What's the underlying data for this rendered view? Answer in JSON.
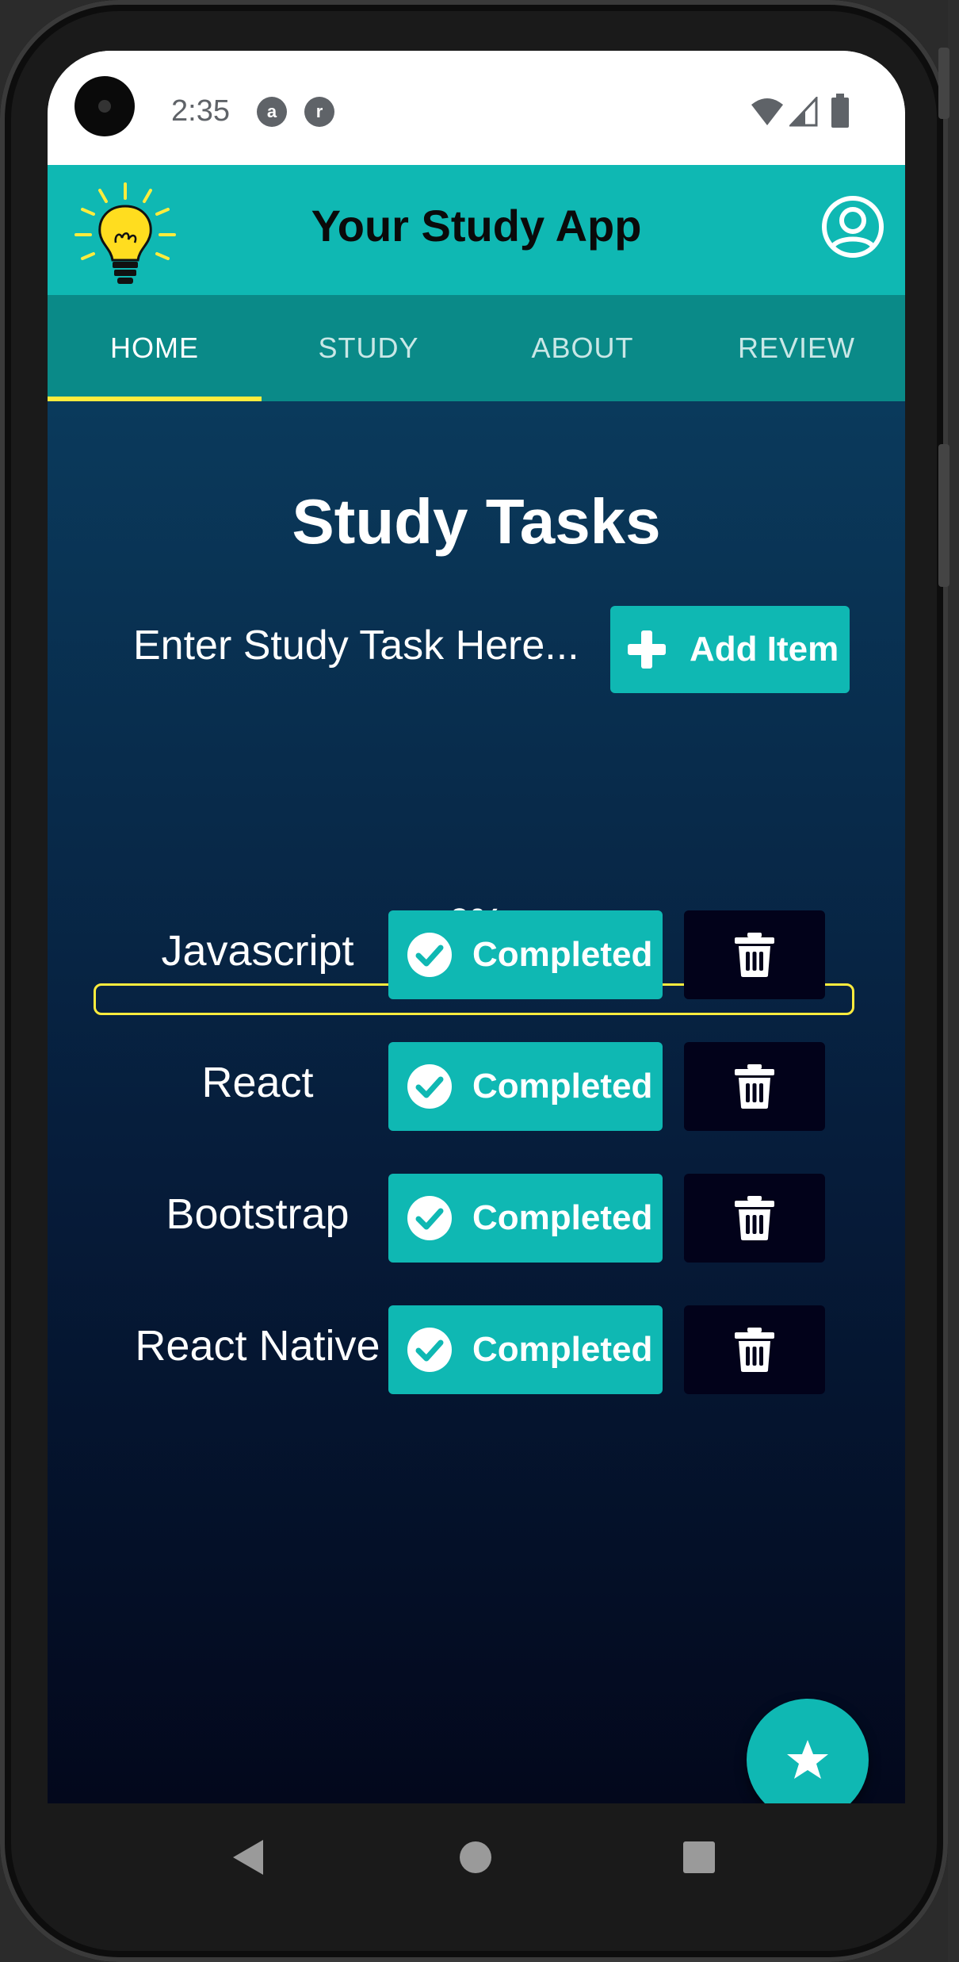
{
  "status_bar": {
    "time": "2:35",
    "notification_icons": [
      "a",
      "r"
    ]
  },
  "header": {
    "title": "Your Study App",
    "logo_icon": "lightbulb-icon",
    "profile_icon": "user-circle-icon"
  },
  "tabs": [
    {
      "label": "HOME",
      "active": true
    },
    {
      "label": "STUDY",
      "active": false
    },
    {
      "label": "ABOUT",
      "active": false
    },
    {
      "label": "REVIEW",
      "active": false
    }
  ],
  "main": {
    "title": "Study Tasks",
    "task_input_placeholder": "Enter Study Task Here...",
    "add_button_label": "Add Item",
    "progress_label": "0%",
    "progress_value": 0,
    "tasks": [
      {
        "name": "Javascript",
        "button_label": "Completed"
      },
      {
        "name": "React",
        "button_label": "Completed"
      },
      {
        "name": "Bootstrap",
        "button_label": "Completed"
      },
      {
        "name": "React Native",
        "button_label": "Completed"
      }
    ]
  },
  "fab_icon": "star-icon",
  "colors": {
    "accent": "#0fb8b3",
    "tab_bar": "#0a8a88",
    "indicator": "#ffec3d",
    "delete_button": "#02021a",
    "background_top": "#0a3a5c",
    "background_bottom": "#03081c"
  }
}
